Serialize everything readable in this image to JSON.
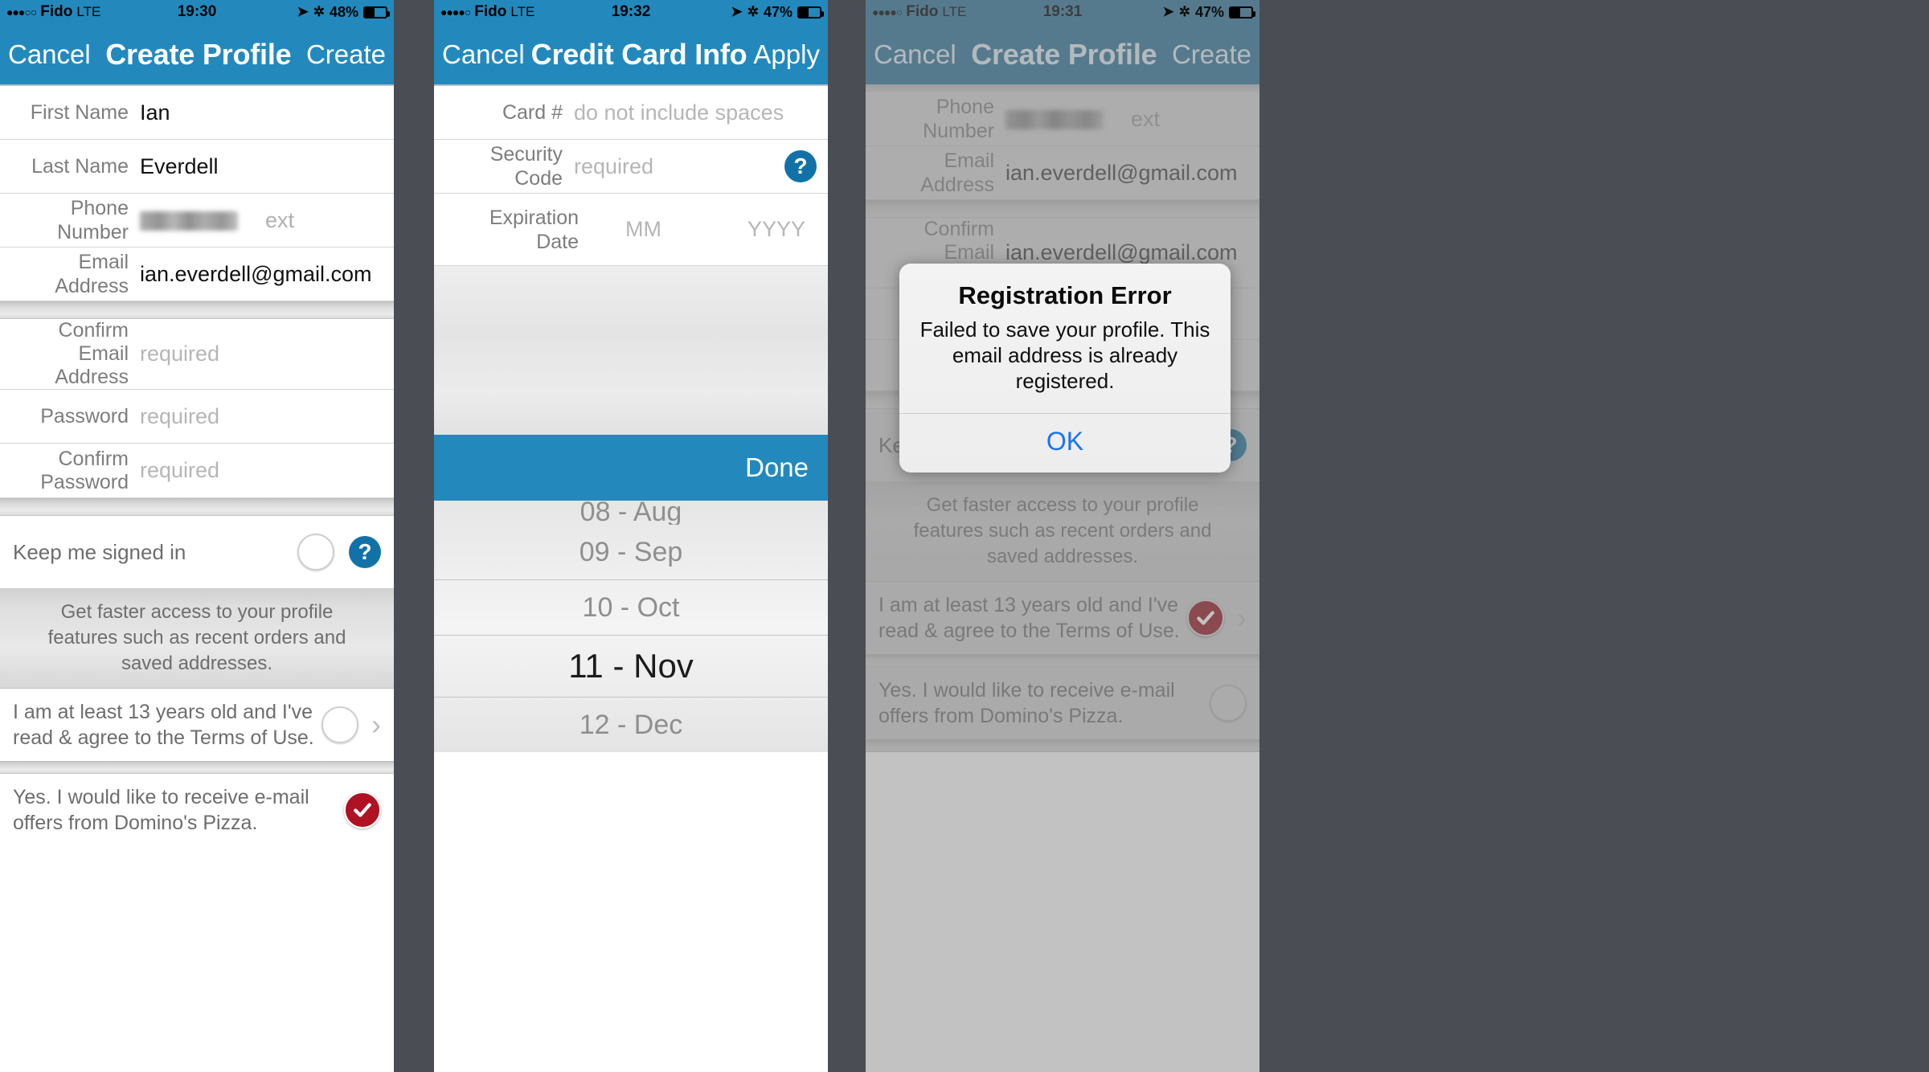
{
  "panels": [
    {
      "status": {
        "dots": "●●●○○",
        "carrier": "Fido",
        "network": "LTE",
        "time": "19:30",
        "battery_pct": "48%",
        "location_icon": "location-arrow-icon",
        "bluetooth_icon": "bluetooth-icon"
      },
      "nav": {
        "left": "Cancel",
        "title": "Create Profile",
        "right": "Create"
      },
      "fields": [
        {
          "label": "First Name",
          "value": "Ian",
          "placeholder": ""
        },
        {
          "label": "Last Name",
          "value": "Everdell",
          "placeholder": ""
        },
        {
          "label": "Phone Number",
          "value": "",
          "redacted": true,
          "ext": "ext"
        },
        {
          "label": "Email Address",
          "value": "ian.everdell@gmail.com",
          "placeholder": ""
        },
        {
          "label": "Confirm Email Address",
          "value": "",
          "placeholder": "required"
        },
        {
          "label": "Password",
          "value": "",
          "placeholder": "required"
        },
        {
          "label": "Confirm Password",
          "value": "",
          "placeholder": "required"
        }
      ],
      "keep_signed_in": {
        "label": "Keep me signed in",
        "checked": false,
        "help": "?"
      },
      "note": "Get faster access to your profile features such as recent orders and saved addresses.",
      "terms": {
        "text": "I am at least 13 years old and I've read & agree to the Terms of Use.",
        "checked": false,
        "chevron": "chevron-right-icon"
      },
      "offers": {
        "text": "Yes. I would like to receive e-mail offers from Domino's Pizza.",
        "checked": true
      }
    },
    {
      "status": {
        "dots": "●●●●○",
        "carrier": "Fido",
        "network": "LTE",
        "time": "19:32",
        "battery_pct": "47%",
        "location_icon": "location-arrow-icon",
        "bluetooth_icon": "bluetooth-icon"
      },
      "nav": {
        "left": "Cancel",
        "title": "Credit Card Info",
        "right": "Apply"
      },
      "fields": [
        {
          "label": "Card #",
          "value": "",
          "placeholder": "do not include spaces"
        },
        {
          "label": "Security Code",
          "value": "",
          "placeholder": "required",
          "help": "?"
        },
        {
          "label": "Expiration Date",
          "value": "",
          "month": "MM",
          "year": "YYYY"
        }
      ],
      "picker": {
        "done_label": "Done",
        "options": [
          "08 - Aug",
          "09 - Sep",
          "10 - Oct",
          "11 - Nov",
          "12 - Dec"
        ],
        "selected": "11 - Nov"
      }
    },
    {
      "status": {
        "dots": "●●●●○",
        "carrier": "Fido",
        "network": "LTE",
        "time": "19:31",
        "battery_pct": "47%",
        "location_icon": "location-arrow-icon",
        "bluetooth_icon": "bluetooth-icon"
      },
      "nav": {
        "left": "Cancel",
        "title": "Create Profile",
        "right": "Create"
      },
      "fields": [
        {
          "label": "Phone Number",
          "value": "",
          "redacted": true,
          "ext": "ext"
        },
        {
          "label": "Email Address",
          "value": "ian.everdell@gmail.com",
          "placeholder": ""
        },
        {
          "label": "Confirm Email Address",
          "value": "ian.everdell@gmail.com",
          "placeholder": ""
        }
      ],
      "keep_signed_in": {
        "label": "Keep me signed in",
        "checked": true,
        "help": "?"
      },
      "note": "Get faster access to your profile features such as recent orders and saved addresses.",
      "terms": {
        "text": "I am at least 13 years old and I've read & agree to the Terms of Use.",
        "checked": true,
        "chevron": "chevron-right-icon"
      },
      "offers": {
        "text": "Yes. I would like to receive e-mail offers from Domino's Pizza.",
        "checked": false
      },
      "alert": {
        "title": "Registration Error",
        "message": "Failed to save your profile. This email address is already registered.",
        "ok_label": "OK"
      }
    }
  ],
  "colors": {
    "brand_blue": "#2389bd",
    "brand_blue_dim": "#3b7d9e",
    "alert_link": "#1b72f0",
    "check_red": "#b01223",
    "gap_gray": "#4a4e54"
  }
}
